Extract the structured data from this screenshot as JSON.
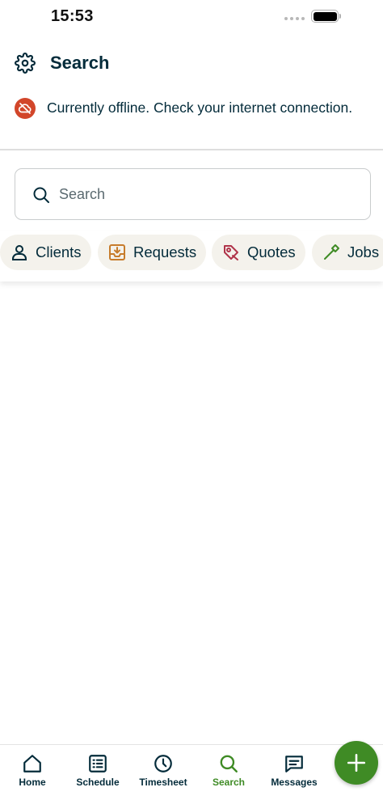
{
  "status_bar": {
    "time": "15:53"
  },
  "header": {
    "title": "Search"
  },
  "offline_banner": {
    "message": "Currently offline. Check your internet connection."
  },
  "search": {
    "placeholder": "Search",
    "value": ""
  },
  "filter_chips": [
    {
      "label": "Clients",
      "icon": "person-icon"
    },
    {
      "label": "Requests",
      "icon": "inbox-download-icon"
    },
    {
      "label": "Quotes",
      "icon": "quote-tag-icon"
    },
    {
      "label": "Jobs",
      "icon": "hammer-icon"
    }
  ],
  "bottom_nav": {
    "items": [
      {
        "label": "Home",
        "icon": "home-icon",
        "active": false
      },
      {
        "label": "Schedule",
        "icon": "schedule-list-icon",
        "active": false
      },
      {
        "label": "Timesheet",
        "icon": "clock-icon",
        "active": false
      },
      {
        "label": "Search",
        "icon": "search-icon",
        "active": true
      },
      {
        "label": "Messages",
        "icon": "message-icon",
        "active": false
      }
    ],
    "fab_icon": "plus-icon"
  },
  "colors": {
    "text_primary": "#032b3a",
    "brand_green": "#3f8b25",
    "offline_red": "#d2462a",
    "chip_bg": "#f4f2ec",
    "requests_accent": "#c77c2c",
    "quotes_accent": "#b0344a",
    "jobs_accent": "#3f8b25"
  }
}
